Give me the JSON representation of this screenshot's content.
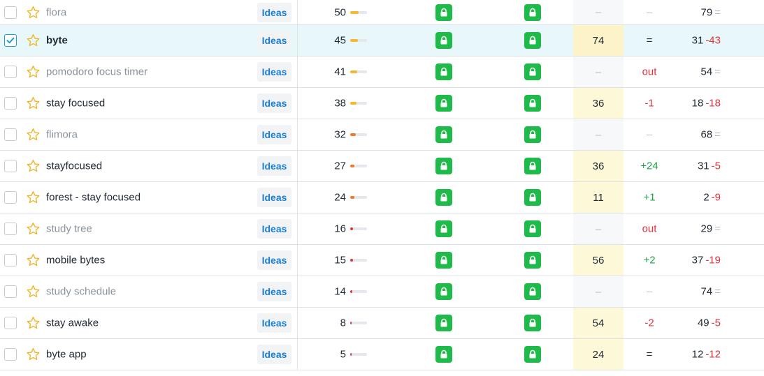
{
  "ideas_label": "Ideas",
  "colors": {
    "lock_green": "#1fbb4a",
    "up_green": "#1ea548",
    "down_red": "#e0323c",
    "link_blue": "#1a7fd4",
    "selected_row": "#e8f8fa",
    "position_cell": "#fdf9d8"
  },
  "rows": [
    {
      "keyword": "flora",
      "muted": true,
      "checked": false,
      "volume": "50",
      "difficulty": 50,
      "position": "–",
      "change": "–",
      "change_kind": "dash",
      "last": "79",
      "last_delta": "=",
      "last_kind": "eq"
    },
    {
      "keyword": "byte",
      "muted": false,
      "bold": true,
      "checked": true,
      "selected": true,
      "volume": "45",
      "difficulty": 45,
      "position": "74",
      "change": "=",
      "change_kind": "eq",
      "last": "31",
      "last_delta": "-43",
      "last_kind": "neg"
    },
    {
      "keyword": "pomodoro focus timer",
      "muted": true,
      "checked": false,
      "volume": "41",
      "difficulty": 41,
      "position": "–",
      "change": "out",
      "change_kind": "neg",
      "last": "54",
      "last_delta": "=",
      "last_kind": "eq"
    },
    {
      "keyword": "stay focused",
      "muted": false,
      "checked": false,
      "volume": "38",
      "difficulty": 38,
      "position": "36",
      "change": "-1",
      "change_kind": "neg",
      "last": "18",
      "last_delta": "-18",
      "last_kind": "neg"
    },
    {
      "keyword": "flimora",
      "muted": true,
      "checked": false,
      "volume": "32",
      "difficulty": 32,
      "position": "–",
      "change": "–",
      "change_kind": "dash",
      "last": "68",
      "last_delta": "=",
      "last_kind": "eq"
    },
    {
      "keyword": "stayfocused",
      "muted": false,
      "checked": false,
      "volume": "27",
      "difficulty": 27,
      "position": "36",
      "change": "+24",
      "change_kind": "up",
      "last": "31",
      "last_delta": "-5",
      "last_kind": "neg"
    },
    {
      "keyword": "forest - stay focused",
      "muted": false,
      "checked": false,
      "volume": "24",
      "difficulty": 24,
      "position": "11",
      "change": "+1",
      "change_kind": "up",
      "last": "2",
      "last_delta": "-9",
      "last_kind": "neg"
    },
    {
      "keyword": "study tree",
      "muted": true,
      "checked": false,
      "volume": "16",
      "difficulty": 16,
      "position": "–",
      "change": "out",
      "change_kind": "neg",
      "last": "29",
      "last_delta": "=",
      "last_kind": "eq"
    },
    {
      "keyword": "mobile bytes",
      "muted": false,
      "checked": false,
      "volume": "15",
      "difficulty": 15,
      "position": "56",
      "change": "+2",
      "change_kind": "up",
      "last": "37",
      "last_delta": "-19",
      "last_kind": "neg"
    },
    {
      "keyword": "study schedule",
      "muted": true,
      "checked": false,
      "volume": "14",
      "difficulty": 14,
      "position": "–",
      "change": "–",
      "change_kind": "dash",
      "last": "74",
      "last_delta": "=",
      "last_kind": "eq"
    },
    {
      "keyword": "stay awake",
      "muted": false,
      "checked": false,
      "volume": "8",
      "difficulty": 8,
      "position": "54",
      "change": "-2",
      "change_kind": "neg",
      "last": "49",
      "last_delta": "-5",
      "last_kind": "neg"
    },
    {
      "keyword": "byte app",
      "muted": false,
      "checked": false,
      "volume": "5",
      "difficulty": 5,
      "position": "24",
      "change": "=",
      "change_kind": "eq",
      "last": "12",
      "last_delta": "-12",
      "last_kind": "neg"
    }
  ]
}
